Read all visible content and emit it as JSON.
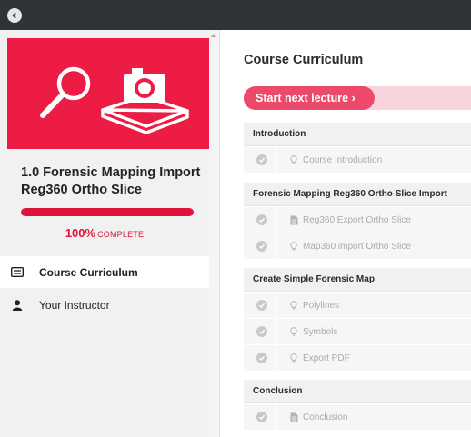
{
  "course": {
    "title": "1.0 Forensic Mapping Import Reg360 Ortho Slice",
    "progress_percent": "100%",
    "progress_label": "COMPLETE",
    "progress_fraction": 1.0
  },
  "sidebar": {
    "items": [
      {
        "label": "Course Curriculum",
        "icon": "curriculum-icon",
        "active": true
      },
      {
        "label": "Your Instructor",
        "icon": "user-icon",
        "active": false
      }
    ]
  },
  "main": {
    "title": "Course Curriculum",
    "next_button": "Start next lecture  ›",
    "sections": [
      {
        "title": "Introduction",
        "lectures": [
          {
            "label": "Course Introduction",
            "icon": "bulb-icon"
          }
        ]
      },
      {
        "title": "Forensic Mapping Reg360 Ortho Slice Import",
        "lectures": [
          {
            "label": "Reg360 Export Ortho Slice",
            "icon": "document-icon"
          },
          {
            "label": "Map360 import Ortho Slice",
            "icon": "bulb-icon"
          }
        ]
      },
      {
        "title": "Create Simple Forensic Map",
        "lectures": [
          {
            "label": "Polylines",
            "icon": "bulb-icon"
          },
          {
            "label": "Symbols",
            "icon": "bulb-icon"
          },
          {
            "label": "Export PDF",
            "icon": "bulb-icon"
          }
        ]
      },
      {
        "title": "Conclusion",
        "lectures": [
          {
            "label": "Conclusion",
            "icon": "document-icon"
          }
        ]
      }
    ]
  },
  "colors": {
    "accent": "#ec1c45",
    "topbar": "#2e3336"
  }
}
